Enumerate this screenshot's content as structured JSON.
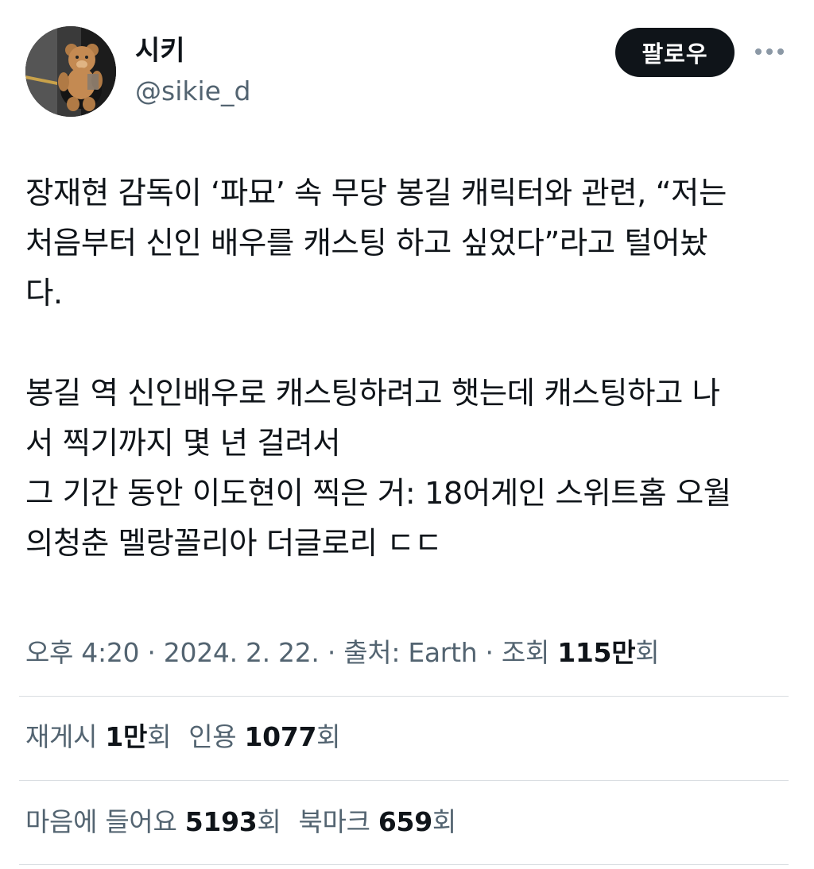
{
  "user": {
    "display_name": "시키",
    "handle": "@sikie_d"
  },
  "actions": {
    "follow_label": "팔로우"
  },
  "tweet": {
    "lines": [
      "장재현 감독이 ‘파묘’ 속 무당 봉길 캐릭터와 관련, “저는",
      "처음부터 신인 배우를 캐스팅 하고 싶었다”라고 털어놨",
      "다.",
      "",
      "봉길 역 신인배우로 캐스팅하려고 햇는데 캐스팅하고 나",
      "서 찍기까지 몇 년 걸려서",
      "그 기간 동안 이도현이 찍은 거: 18어게인 스위트홈 오월",
      "의청춘 멜랑꼴리아 더글로리 ㄷㄷ"
    ]
  },
  "meta": {
    "time": "오후 4:20",
    "separator": " · ",
    "date": "2024. 2. 22.",
    "source_label": "출처: Earth",
    "views_label": "조회",
    "views_value": "115만",
    "views_suffix": "회"
  },
  "stats": {
    "retweets_label": "재게시",
    "retweets_value": "1만",
    "retweets_suffix": "회",
    "quotes_label": "인용",
    "quotes_value": "1077",
    "quotes_suffix": "회",
    "likes_label": "마음에 들어요",
    "likes_value": "5193",
    "likes_suffix": "회",
    "bookmarks_label": "북마크",
    "bookmarks_value": "659",
    "bookmarks_suffix": "회"
  },
  "icons": {
    "avatar": "teddy-bear-avatar",
    "more": "more-horizontal-icon"
  }
}
